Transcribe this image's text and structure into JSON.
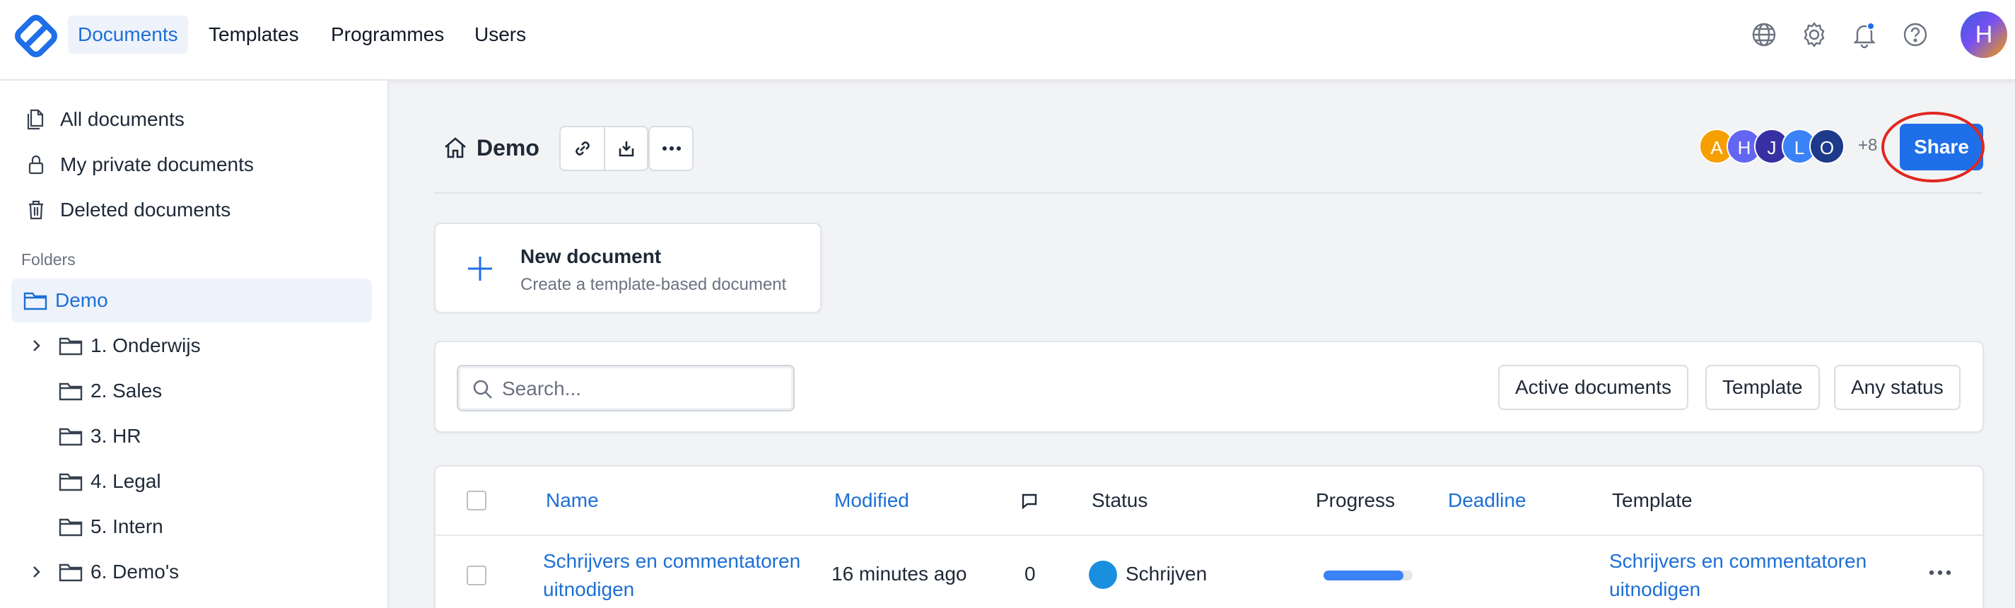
{
  "nav": {
    "items": [
      {
        "label": "Documents",
        "active": true
      },
      {
        "label": "Templates",
        "active": false
      },
      {
        "label": "Programmes",
        "active": false
      },
      {
        "label": "Users",
        "active": false
      }
    ],
    "icons": [
      "globe-icon",
      "gear-icon",
      "bell-icon",
      "help-icon"
    ],
    "user_initial": "H"
  },
  "sidebar": {
    "items": [
      {
        "label": "All documents",
        "icon": "documents-icon"
      },
      {
        "label": "My private documents",
        "icon": "lock-icon"
      },
      {
        "label": "Deleted documents",
        "icon": "trash-icon"
      }
    ],
    "folders_heading": "Folders",
    "root_folder": "Demo",
    "folders": [
      {
        "label": "1. Onderwijs",
        "expandable": true
      },
      {
        "label": "2. Sales",
        "expandable": false
      },
      {
        "label": "3. HR",
        "expandable": false
      },
      {
        "label": "4. Legal",
        "expandable": false
      },
      {
        "label": "5. Intern",
        "expandable": false
      },
      {
        "label": "6. Demo's",
        "expandable": true
      }
    ]
  },
  "header": {
    "title": "Demo",
    "collaborators": [
      {
        "initial": "A",
        "color": "#f59f00"
      },
      {
        "initial": "H",
        "color": "#6366f1"
      },
      {
        "initial": "J",
        "color": "#3730a3"
      },
      {
        "initial": "L",
        "color": "#3b82f6"
      },
      {
        "initial": "O",
        "color": "#1e3a8a"
      }
    ],
    "more_count": "+8",
    "share_label": "Share"
  },
  "new_document": {
    "title": "New document",
    "subtitle": "Create a template-based document"
  },
  "filters": {
    "search_placeholder": "Search...",
    "buttons": [
      "Active documents",
      "Template",
      "Any status"
    ]
  },
  "table": {
    "columns": {
      "name": "Name",
      "modified": "Modified",
      "status": "Status",
      "progress": "Progress",
      "deadline": "Deadline",
      "template": "Template"
    },
    "rows": [
      {
        "name": "Schrijvers en commentatoren uitnodigen",
        "modified": "16 minutes ago",
        "comments": "0",
        "status": "Schrijven",
        "status_color": "#1a8fe0",
        "progress": 0.9,
        "deadline": "",
        "template": "Schrijvers en commentatoren uitnodigen"
      }
    ]
  }
}
